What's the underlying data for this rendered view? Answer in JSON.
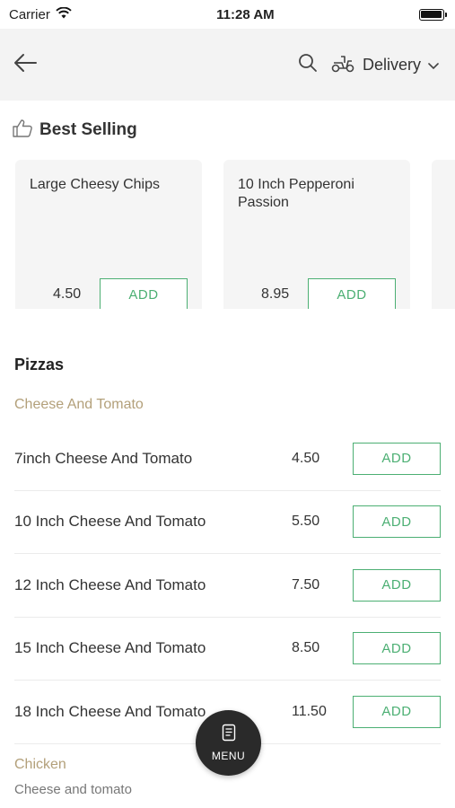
{
  "status_bar": {
    "carrier": "Carrier",
    "time": "11:28 AM"
  },
  "header": {
    "delivery_label": "Delivery"
  },
  "best_selling": {
    "title": "Best Selling",
    "items": [
      {
        "name": "Large Cheesy Chips",
        "price": "4.50",
        "add_label": "ADD"
      },
      {
        "name": "10 Inch Pepperoni Passion",
        "price": "8.95",
        "add_label": "ADD"
      }
    ]
  },
  "pizzas": {
    "title": "Pizzas",
    "subcategory": "Cheese And Tomato",
    "items": [
      {
        "name": "7inch Cheese And Tomato",
        "price": "4.50",
        "add_label": "ADD"
      },
      {
        "name": "10 Inch Cheese And Tomato",
        "price": "5.50",
        "add_label": "ADD"
      },
      {
        "name": "12 Inch Cheese And Tomato",
        "price": "7.50",
        "add_label": "ADD"
      },
      {
        "name": "15 Inch Cheese And Tomato",
        "price": "8.50",
        "add_label": "ADD"
      },
      {
        "name": "18 Inch Cheese And Tomato",
        "price": "11.50",
        "add_label": "ADD"
      }
    ]
  },
  "chicken": {
    "title": "Chicken",
    "description": "Cheese and tomato"
  },
  "menu_button": {
    "label": "MENU"
  },
  "colors": {
    "accent": "#4caf73",
    "subcategory": "#b3a07a",
    "header_bg": "#f3f3f3",
    "fab_bg": "#2a2a2a"
  }
}
